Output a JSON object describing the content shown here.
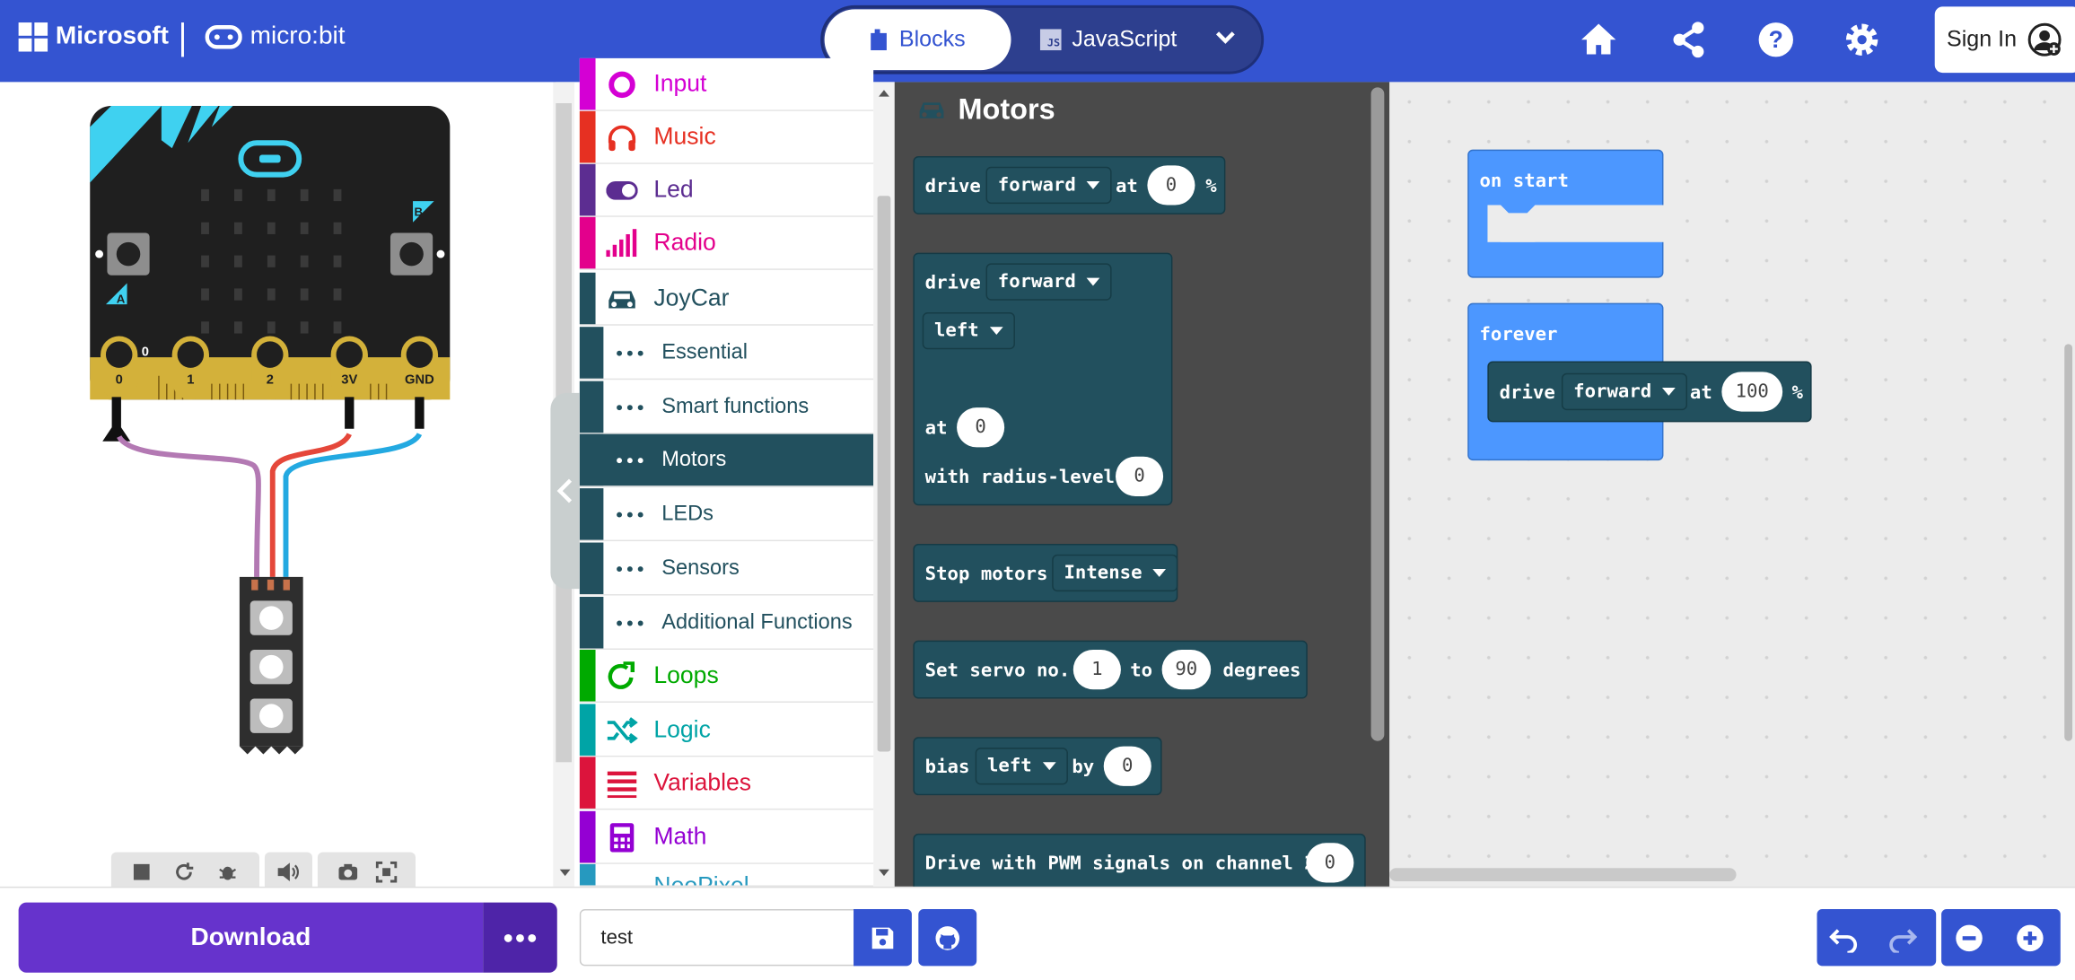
{
  "header": {
    "brand": "Microsoft",
    "product": "micro:bit",
    "tab_blocks": "Blocks",
    "tab_js": "JavaScript",
    "js_badge": "JS",
    "sign_in": "Sign In",
    "accent": "#3454d1"
  },
  "simulator": {
    "pin_labels": [
      "0",
      "1",
      "2",
      "3V",
      "GND"
    ],
    "button_a": "A",
    "button_b": "B",
    "pin0_reading": "0",
    "toolbar_icons": [
      "stop-icon",
      "restart-icon",
      "debug-icon",
      "mute-icon",
      "screenshot-icon",
      "fullscreen-icon"
    ]
  },
  "toolbox": {
    "categories": [
      {
        "label": "Input",
        "color": "#d400d4"
      },
      {
        "label": "Music",
        "color": "#e63022"
      },
      {
        "label": "Led",
        "color": "#5c2d91"
      },
      {
        "label": "Radio",
        "color": "#e3008c"
      },
      {
        "label": "JoyCar",
        "color": "#22505e"
      }
    ],
    "joycar_sub": [
      "Essential",
      "Smart functions",
      "Motors",
      "LEDs",
      "Sensors",
      "Additional Functions"
    ],
    "categories_after": [
      {
        "label": "Loops",
        "color": "#00aa00"
      },
      {
        "label": "Logic",
        "color": "#00a4a6"
      },
      {
        "label": "Variables",
        "color": "#dc143c"
      },
      {
        "label": "Math",
        "color": "#9400d3"
      },
      {
        "label": "NeoPixel",
        "color": "#2699bf"
      }
    ]
  },
  "flyout": {
    "title": "Motors",
    "b1": {
      "t1": "drive",
      "dir": "forward",
      "t2": "at",
      "val": "0",
      "unit": "%"
    },
    "b2": {
      "t1": "drive",
      "dir": "forward",
      "side": "left",
      "t2": "at",
      "val": "0",
      "t3": "with radius-level",
      "radius": "0"
    },
    "b3": {
      "t1": "Stop motors",
      "mode": "Intense"
    },
    "b4": {
      "t1": "Set servo no.",
      "servo": "1",
      "t2": "to",
      "deg": "90",
      "t3": "degrees"
    },
    "b5": {
      "t1": "bias",
      "side": "left",
      "t2": "by",
      "val": "0"
    },
    "b6": {
      "t1": "Drive with PWM signals on channel 2",
      "val": "0"
    }
  },
  "workspace": {
    "on_start": "on start",
    "forever": "forever",
    "inner": {
      "t1": "drive",
      "dir": "forward",
      "t2": "at",
      "val": "100",
      "unit": "%"
    }
  },
  "footer": {
    "download": "Download",
    "project_name": "test"
  }
}
